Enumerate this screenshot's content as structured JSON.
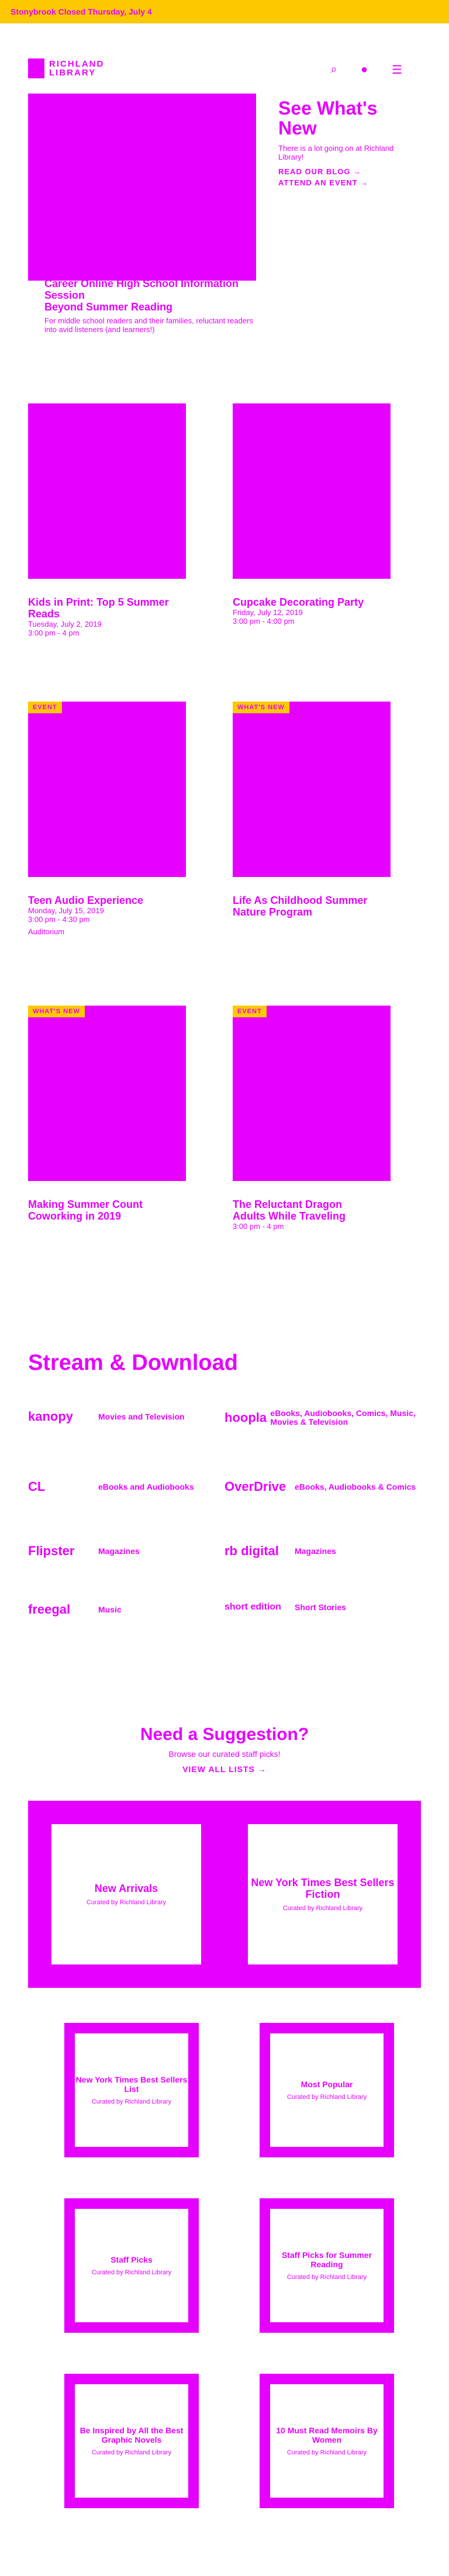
{
  "alert": "Stonybrook Closed Thursday, July 4",
  "header": {
    "logo_line1": "RICHLAND",
    "logo_line2": "LIBRARY"
  },
  "hero": {
    "heading": "See What's New",
    "body": "There is a lot going on at Richland Library!",
    "link_blog": "READ OUR BLOG →",
    "link_event": "ATTEND AN EVENT →",
    "feature_title": "Career Online High School Information Session",
    "feature_title2": "Beyond Summer Reading",
    "feature_body": "For middle school readers and their families, reluctant readers into avid listeners (and learners!)"
  },
  "cards": [
    {
      "title": "Kids in Print: Top 5 Summer Reads",
      "date": "Tuesday, July 2, 2019",
      "time": "3:00 pm - 4 pm",
      "badge": ""
    },
    {
      "title": "Cupcake Decorating Party",
      "date": "Friday, July 12, 2019",
      "time": "3:00 pm - 4:00 pm",
      "badge": ""
    },
    {
      "title": "Teen Audio Experience",
      "date": "Monday, July 15, 2019",
      "time": "3:00 pm - 4:30 pm",
      "badge": "EVENT",
      "extra": "Auditorium"
    },
    {
      "title": "Life As Childhood Summer Nature Program",
      "date": "",
      "time": "",
      "badge": "WHAT'S NEW",
      "extra": ""
    },
    {
      "title": "Making Summer Count",
      "date": "",
      "time": "",
      "badge": "WHAT'S NEW",
      "extra": "Coworking in 2019"
    },
    {
      "title": "The Reluctant Dragon",
      "date": "",
      "time": "3:00 pm - 4 pm",
      "badge": "EVENT",
      "extra": "Adults While Traveling"
    }
  ],
  "stream": {
    "heading": "Stream & Download",
    "items": [
      {
        "logo": "kanopy",
        "desc": "Movies and Television"
      },
      {
        "logo": "hoopla",
        "desc": "eBooks, Audiobooks, Comics, Music, Movies & Television"
      },
      {
        "logo": "CL",
        "desc": "eBooks and Audiobooks"
      },
      {
        "logo": "OverDrive",
        "desc": "eBooks, Audiobooks & Comics"
      },
      {
        "logo": "Flipster",
        "desc": "Magazines"
      },
      {
        "logo": "rb digital",
        "desc": "Magazines"
      },
      {
        "logo": "freegal",
        "desc": "Music"
      },
      {
        "logo": "short edition",
        "desc": "Short Stories"
      }
    ]
  },
  "suggest": {
    "heading": "Need a Suggestion?",
    "sub": "Browse our curated staff picks!",
    "link": "VIEW ALL LISTS →",
    "lists": [
      {
        "title": "New Arrivals",
        "sub": "Curated by Richland Library"
      },
      {
        "title": "New York Times Best Sellers Fiction",
        "sub": "Curated by Richland Library"
      },
      {
        "title": "New York Times Best Sellers List",
        "sub": "Curated by Richland Library"
      },
      {
        "title": "Most Popular",
        "sub": "Curated by Richland Library"
      },
      {
        "title": "Staff Picks",
        "sub": "Curated by Richland Library"
      },
      {
        "title": "Staff Picks for Summer Reading",
        "sub": "Curated by Richland Library"
      },
      {
        "title": "Be Inspired by All the Best Graphic Novels",
        "sub": "Curated by Richland Library"
      },
      {
        "title": "10 Must Read Memoirs By Women",
        "sub": "Curated by Richland Library"
      }
    ]
  }
}
